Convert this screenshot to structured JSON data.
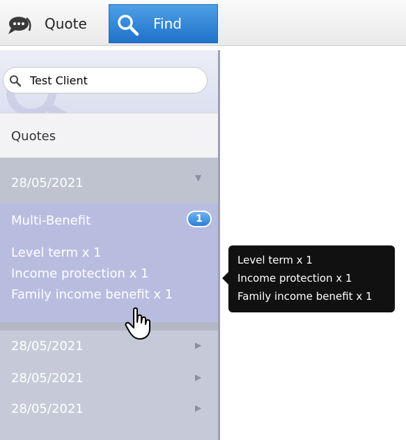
{
  "tabs": {
    "quote_label": "Quote",
    "find_label": "Find"
  },
  "search": {
    "value": "Test Client"
  },
  "section": {
    "title": "Quotes"
  },
  "quotes": [
    {
      "date": "28/05/2021",
      "expanded": true
    },
    {
      "date": "28/05/2021",
      "expanded": false
    },
    {
      "date": "28/05/2021",
      "expanded": false
    },
    {
      "date": "28/05/2021",
      "expanded": false
    }
  ],
  "expanded_quote": {
    "title": "Multi-Benefit",
    "badge_count": "1",
    "lines": [
      "Level term x 1",
      "Income protection x 1",
      "Family income benefit x 1"
    ]
  },
  "tooltip": {
    "lines": [
      "Level term x 1",
      "Income protection x 1",
      "Family income benefit x 1"
    ]
  },
  "colors": {
    "accent_blue": "#1f72c9",
    "sidebar_bg": "#c6cad8",
    "expanded_bg": "#b8bde0",
    "tooltip_bg": "#111111"
  },
  "icons": {
    "quote_tab": "chat-bubble-icon",
    "find_tab": "magnifier-icon",
    "search": "search-icon",
    "collapse": "triangle-down-icon",
    "expand": "triangle-right-icon",
    "pointer": "hand-cursor-icon"
  }
}
